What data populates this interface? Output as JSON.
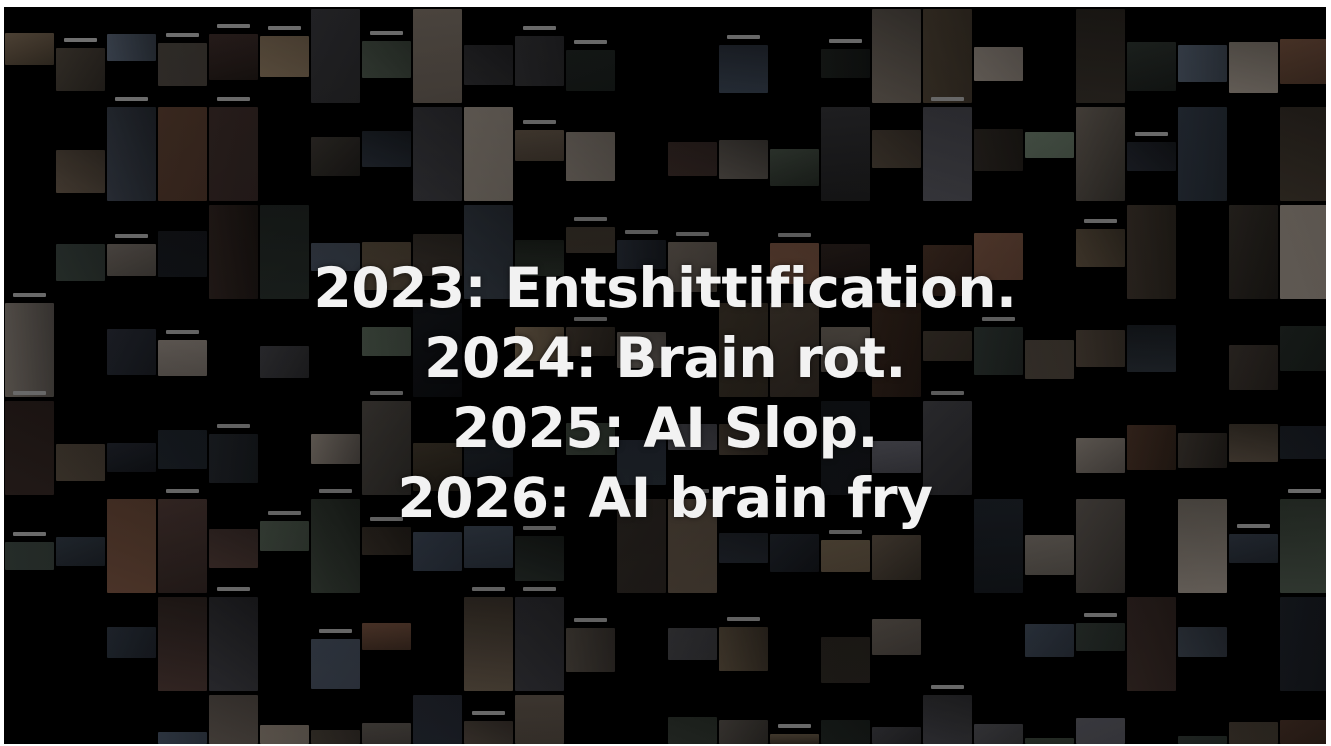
{
  "slide": {
    "lines": [
      "2023: Entshittification.",
      "2024: Brain rot.",
      "2025: AI Slop.",
      "2026: AI brain fry"
    ],
    "text_color": "#f2f2f2",
    "background_color": "#000000",
    "background_description_icon": "video-thumbnail-collage"
  }
}
